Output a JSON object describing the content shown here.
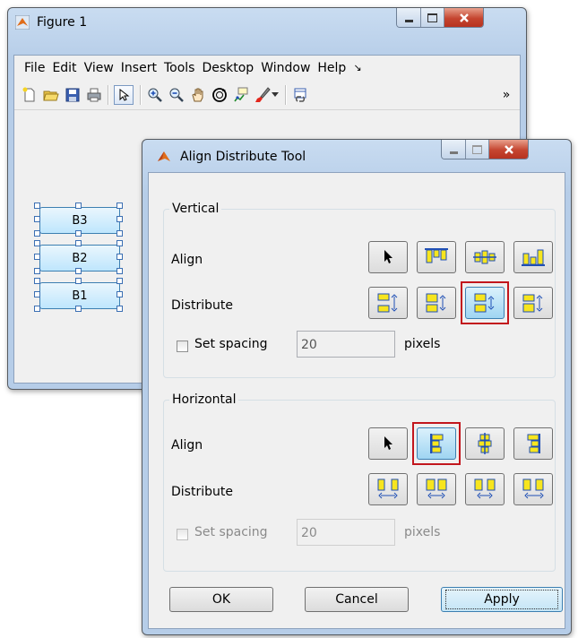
{
  "figure": {
    "title": "Figure 1",
    "menu": [
      "File",
      "Edit",
      "View",
      "Insert",
      "Tools",
      "Desktop",
      "Window",
      "Help"
    ],
    "menu_overflow": "↘",
    "toolbar_overflow": "»",
    "buttons": [
      {
        "label": "B3"
      },
      {
        "label": "B2"
      },
      {
        "label": "B1"
      }
    ]
  },
  "dialog": {
    "title": "Align Distribute Tool",
    "vertical": {
      "group_label": "Vertical",
      "align_label": "Align",
      "distribute_label": "Distribute",
      "set_spacing_label": "Set spacing",
      "spacing_value": "20",
      "units_label": "pixels",
      "set_spacing_checked": false
    },
    "horizontal": {
      "group_label": "Horizontal",
      "align_label": "Align",
      "distribute_label": "Distribute",
      "set_spacing_label": "Set spacing",
      "spacing_value": "20",
      "units_label": "pixels",
      "set_spacing_checked": false,
      "set_spacing_enabled": false
    },
    "ok_label": "OK",
    "cancel_label": "Cancel",
    "apply_label": "Apply"
  },
  "colors": {
    "highlight": "#c2161d",
    "icon_yellow": "#f7e51e",
    "icon_blue": "#1f4fb5",
    "matlab_orange": "#e06d1a"
  }
}
